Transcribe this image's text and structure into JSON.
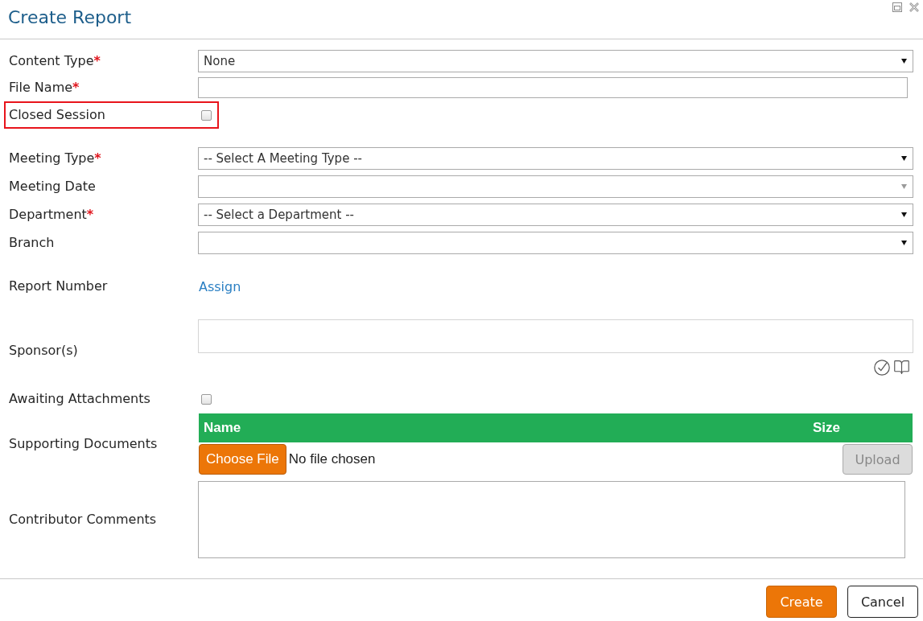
{
  "window": {
    "title": "Create Report"
  },
  "field_groups": [
    {
      "fields": [
        {
          "kind": "select",
          "label": "Content Type",
          "required_mark": "*",
          "value": "None",
          "disabled": false
        },
        {
          "kind": "text",
          "label": "File Name",
          "required_mark": "*"
        },
        {
          "kind": "checkbox",
          "label": "Closed Session",
          "checked": false,
          "highlighted": true
        }
      ]
    },
    {
      "fields": [
        {
          "kind": "select",
          "label": "Meeting Type",
          "required_mark": "*",
          "value": "-- Select A Meeting Type --",
          "disabled": false
        },
        {
          "kind": "select",
          "label": "Meeting Date",
          "disabled": true
        },
        {
          "kind": "select",
          "label": "Department",
          "required_mark": "*",
          "value": "-- Select a Department --",
          "disabled": false
        },
        {
          "kind": "select",
          "label": "Branch",
          "disabled": false
        }
      ]
    },
    {
      "fields": [
        {
          "kind": "link",
          "label": "Report Number",
          "link": "Assign"
        },
        {
          "kind": "sponsors",
          "label": "Sponsor(s)"
        },
        {
          "kind": "checkbox",
          "label": "Awaiting Attachments",
          "checked": false,
          "highlighted": false
        },
        {
          "kind": "documents",
          "label": "Supporting Documents",
          "columns": [
            "Name",
            "Size"
          ],
          "choose_button": "Choose File",
          "file_status": "No file chosen",
          "upload": {
            "label": "Upload",
            "disabled": true
          }
        },
        {
          "kind": "textarea",
          "label": "Contributor Comments"
        }
      ]
    }
  ],
  "buttons": [
    {
      "label": "Create",
      "kind": "primary"
    },
    {
      "label": "Cancel",
      "kind": "secondary"
    }
  ]
}
